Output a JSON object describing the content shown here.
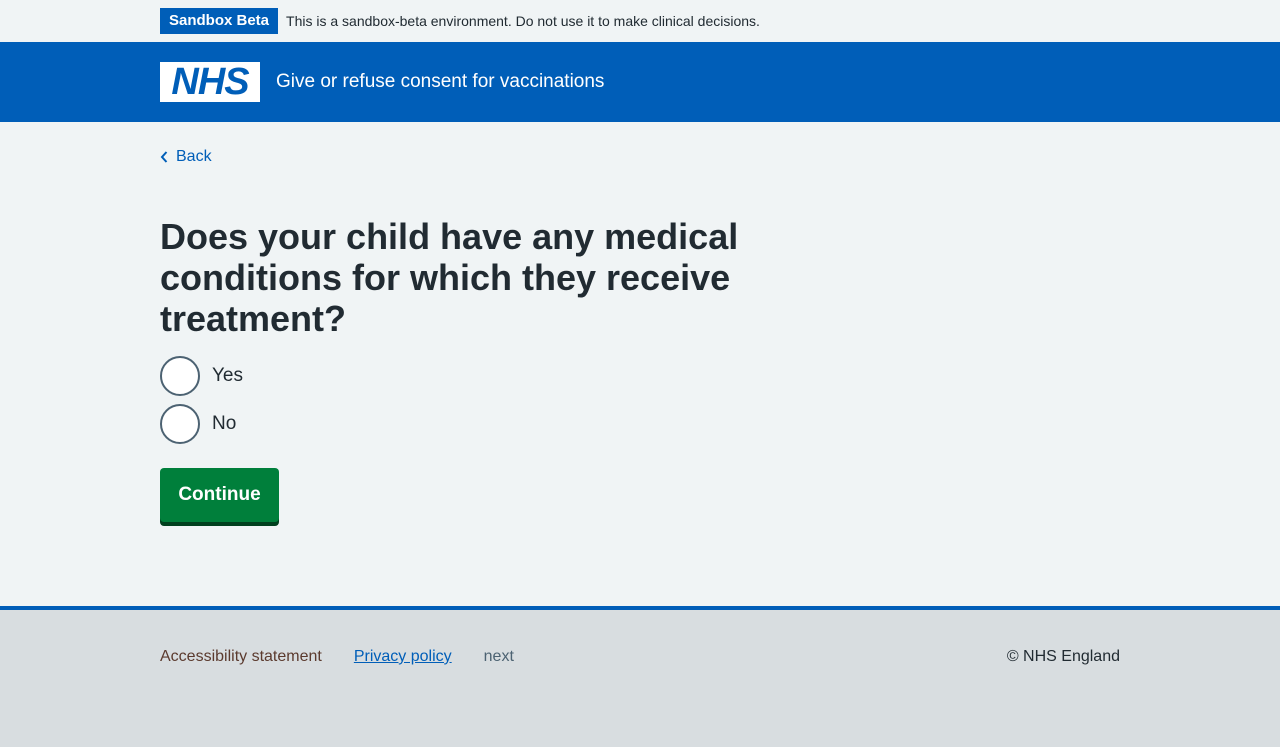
{
  "phase_banner": {
    "tag": "Sandbox Beta",
    "text": "This is a sandbox-beta environment. Do not use it to make clinical decisions."
  },
  "header": {
    "logo_text": "NHS",
    "service_name": "Give or refuse consent for vaccinations"
  },
  "nav": {
    "back_label": "Back"
  },
  "question": {
    "heading": "Does your child have any medical conditions for which they receive treatment?",
    "options": [
      {
        "label": "Yes",
        "selected": false
      },
      {
        "label": "No",
        "selected": false
      }
    ]
  },
  "actions": {
    "continue_label": "Continue"
  },
  "footer": {
    "links": [
      "Accessibility statement",
      "Privacy policy",
      "next"
    ],
    "copyright": "© NHS England"
  },
  "colors": {
    "nhs_blue": "#005eb8",
    "button_green": "#007f3b",
    "page_background": "#f0f4f5",
    "footer_background": "#d8dde0"
  }
}
